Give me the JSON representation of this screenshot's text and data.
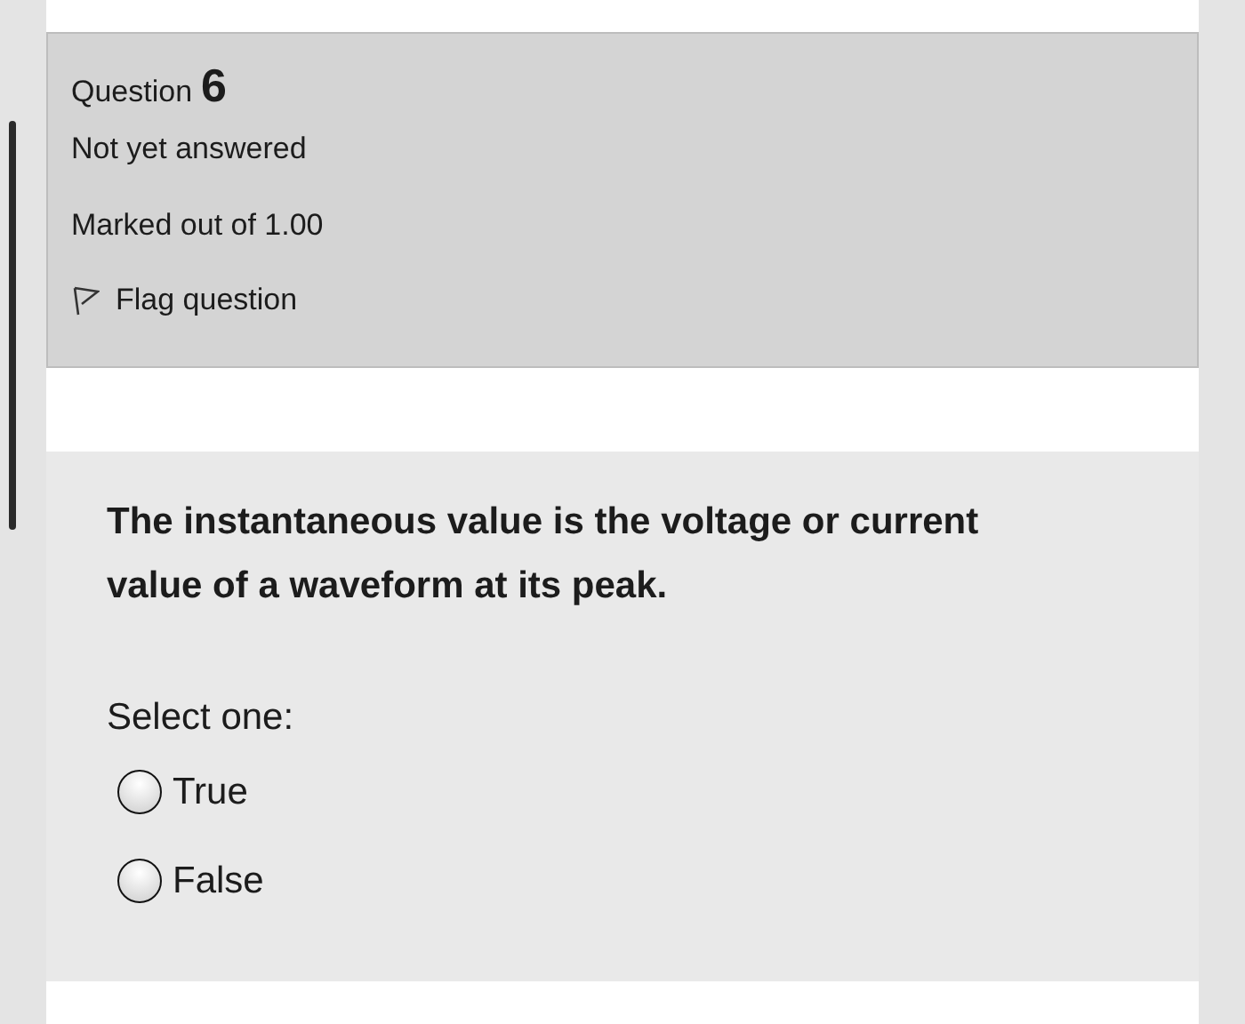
{
  "info": {
    "label": "Question",
    "number": "6",
    "state": "Not yet answered",
    "marks": "Marked out of 1.00",
    "flag": {
      "label": "Flag question",
      "flagged": false
    }
  },
  "question": {
    "text": "The instantaneous value is the voltage or current value of a waveform at its peak.",
    "prompt": "Select one:",
    "options": [
      {
        "label": "True",
        "selected": false
      },
      {
        "label": "False",
        "selected": false
      }
    ]
  }
}
